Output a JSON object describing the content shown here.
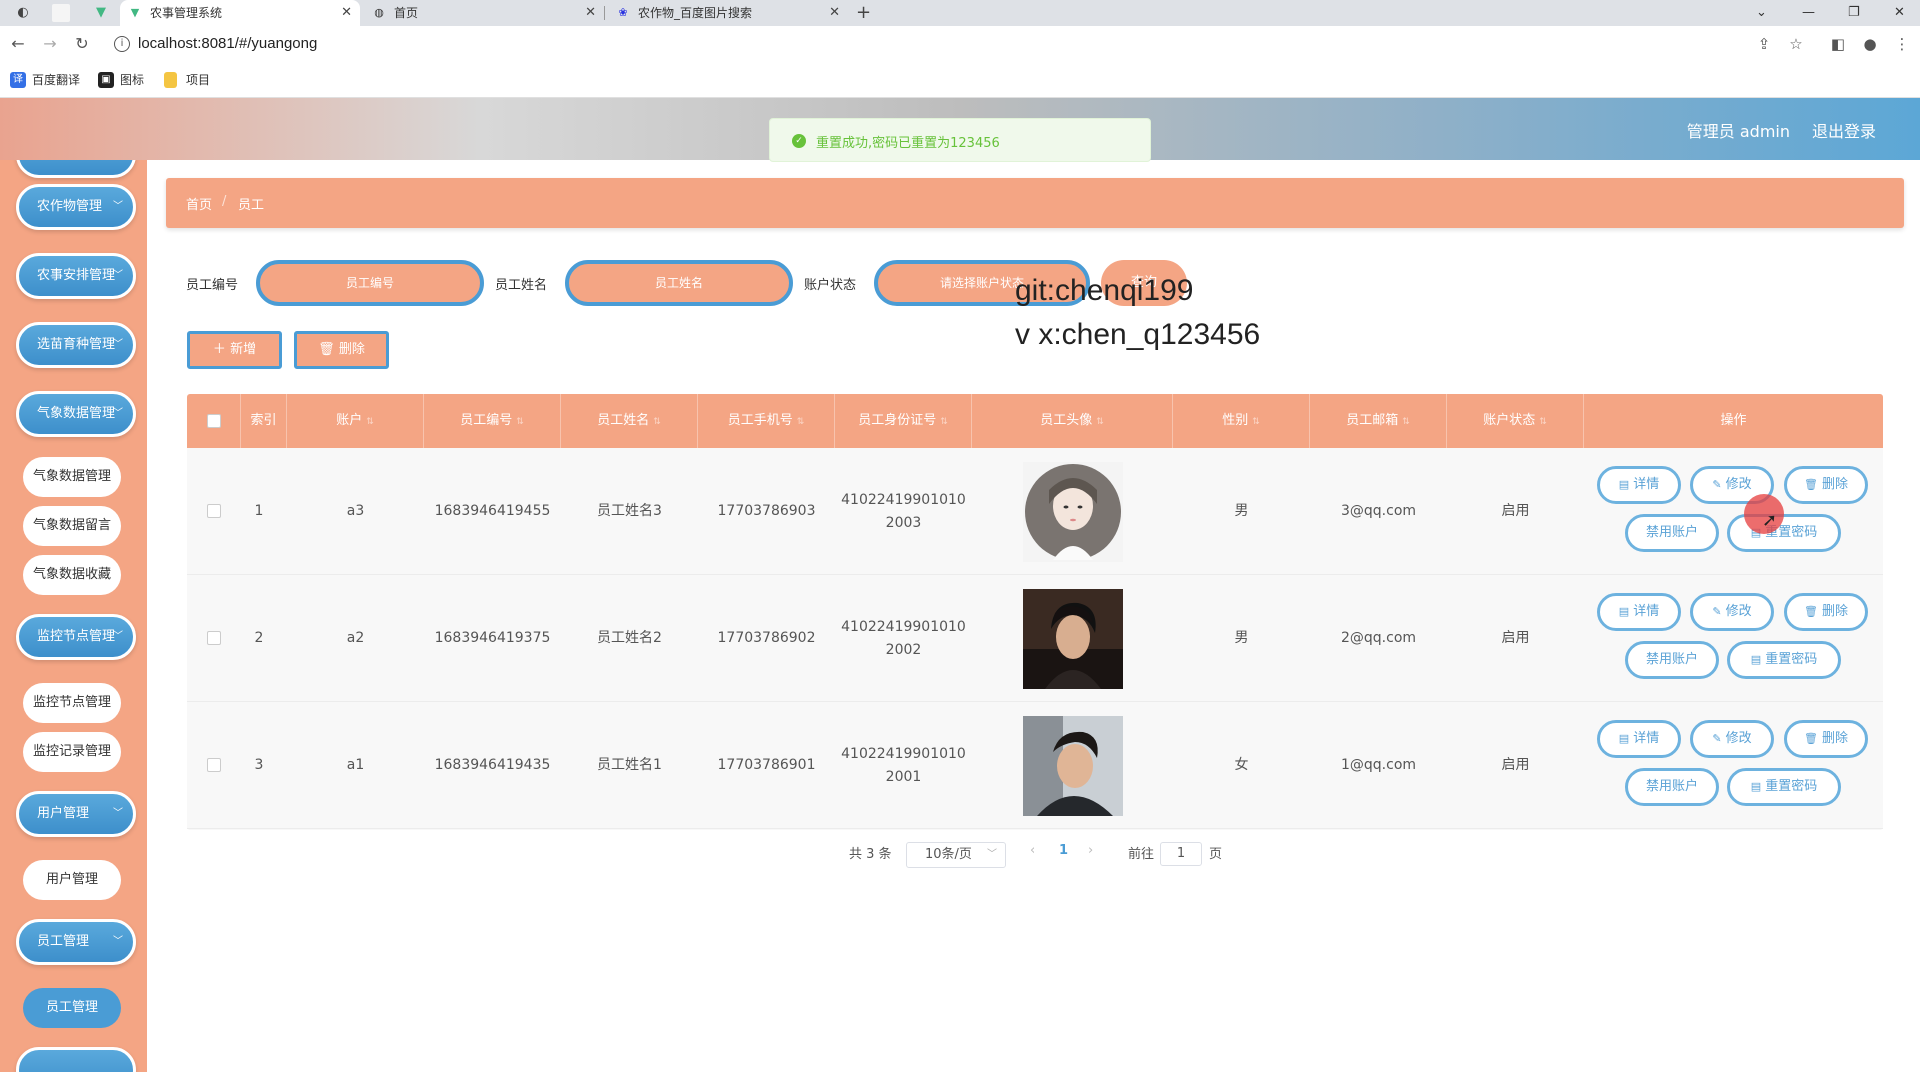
{
  "browser": {
    "tabs": [
      {
        "title": "农事管理系统",
        "active": true
      },
      {
        "title": "首页",
        "active": false
      },
      {
        "title": "农作物_百度图片搜索",
        "active": false
      }
    ],
    "url": "localhost:8081/#/yuangong",
    "bookmarks": [
      "百度翻译",
      "图标",
      "项目"
    ]
  },
  "header": {
    "user_label": "管理员 admin",
    "logout_label": "退出登录"
  },
  "toast": {
    "message": "重置成功,密码已重置为123456",
    "color": "#67c23a"
  },
  "sidebar": {
    "items": [
      {
        "label": "农作物管理",
        "type": "group"
      },
      {
        "label": "农事安排管理",
        "type": "group"
      },
      {
        "label": "选苗育种管理",
        "type": "group"
      },
      {
        "label": "气象数据管理",
        "type": "group"
      },
      {
        "label": "气象数据管理",
        "type": "sub"
      },
      {
        "label": "气象数据留言",
        "type": "sub"
      },
      {
        "label": "气象数据收藏",
        "type": "sub"
      },
      {
        "label": "监控节点管理",
        "type": "group"
      },
      {
        "label": "监控节点管理",
        "type": "sub"
      },
      {
        "label": "监控记录管理",
        "type": "sub"
      },
      {
        "label": "用户管理",
        "type": "group"
      },
      {
        "label": "用户管理",
        "type": "sub"
      },
      {
        "label": "员工管理",
        "type": "group"
      },
      {
        "label": "员工管理",
        "type": "sub",
        "active": true
      }
    ]
  },
  "breadcrumb": {
    "home": "首页",
    "separator": "/",
    "current": "员工"
  },
  "search": {
    "fields": [
      {
        "label": "员工编号",
        "placeholder": "员工编号"
      },
      {
        "label": "员工姓名",
        "placeholder": "员工姓名"
      },
      {
        "label": "账户状态",
        "placeholder": "请选择账户状态"
      }
    ],
    "button": "查询"
  },
  "watermark": {
    "line1": "git:chenqi199",
    "line2": "v x:chen_q123456"
  },
  "actions": {
    "add": "新增",
    "delete": "删除"
  },
  "table": {
    "headers": [
      "索引",
      "账户",
      "员工编号",
      "员工姓名",
      "员工手机号",
      "员工身份证号",
      "员工头像",
      "性别",
      "员工邮箱",
      "账户状态",
      "操作"
    ],
    "rows": [
      {
        "index": "1",
        "account": "a3",
        "emp_no": "1683946419455",
        "name": "员工姓名3",
        "phone": "17703786903",
        "id_line1": "41022419901010",
        "id_line2": "2003",
        "avatar": "avatar-female-illustration",
        "gender": "男",
        "email": "3@qq.com",
        "status": "启用"
      },
      {
        "index": "2",
        "account": "a2",
        "emp_no": "1683946419375",
        "name": "员工姓名2",
        "phone": "17703786902",
        "id_line1": "41022419901010",
        "id_line2": "2002",
        "avatar": "avatar-male-photo",
        "gender": "男",
        "email": "2@qq.com",
        "status": "启用"
      },
      {
        "index": "3",
        "account": "a1",
        "emp_no": "1683946419435",
        "name": "员工姓名1",
        "phone": "17703786901",
        "id_line1": "41022419901010",
        "id_line2": "2001",
        "avatar": "avatar-male-photo",
        "gender": "女",
        "email": "1@qq.com",
        "status": "启用"
      }
    ],
    "row_buttons": {
      "detail": "详情",
      "edit": "修改",
      "delete": "删除",
      "disable": "禁用账户",
      "reset": "重置密码"
    }
  },
  "pagination": {
    "total": "共 3 条",
    "page_size": "10条/页",
    "current_page": "1",
    "goto_label": "前往",
    "goto_value": "1",
    "page_suffix": "页"
  },
  "colors": {
    "primary_salmon": "#f4a584",
    "accent_blue": "#4a9cd5"
  }
}
